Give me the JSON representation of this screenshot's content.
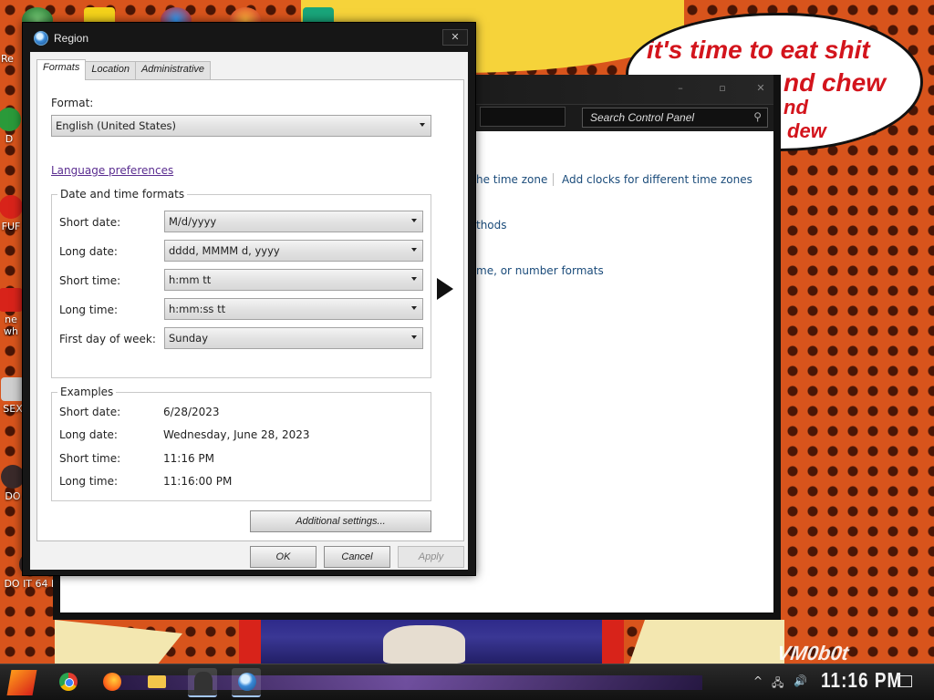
{
  "desktop": {
    "speech_bubble": {
      "line1": "it's time to eat shit",
      "line2": "nd chew",
      "line3": "nd",
      "line4": "dew"
    },
    "watermark": "VM0b0t",
    "icons": [
      {
        "label": "Re"
      },
      {
        "label": "D"
      },
      {
        "label": "FUF"
      },
      {
        "label": "ne"
      },
      {
        "label": "wh"
      },
      {
        "label": "SEX"
      },
      {
        "label": "DO"
      },
      {
        "label": "DO IT 64 B"
      }
    ]
  },
  "control_panel": {
    "search_placeholder": "Search Control Panel",
    "titlebar_buttons": {
      "minimize": "–",
      "maximize": "▫",
      "close": "✕"
    },
    "links": {
      "time_zone": "he time zone",
      "add_clocks": "Add clocks for different time zones",
      "methods": "thods",
      "formats": "me, or number formats"
    }
  },
  "region_dialog": {
    "title": "Region",
    "close_glyph": "✕",
    "tabs": [
      {
        "label": "Formats",
        "active": true
      },
      {
        "label": "Location",
        "active": false
      },
      {
        "label": "Administrative",
        "active": false
      }
    ],
    "format": {
      "label": "Format:",
      "value": "English (United States)"
    },
    "language_link": "Language preferences",
    "date_time_group": {
      "title": "Date and time formats",
      "rows": [
        {
          "label": "Short date:",
          "value": "M/d/yyyy"
        },
        {
          "label": "Long date:",
          "value": "dddd, MMMM d, yyyy"
        },
        {
          "label": "Short time:",
          "value": "h:mm tt"
        },
        {
          "label": "Long time:",
          "value": "h:mm:ss tt"
        },
        {
          "label": "First day of week:",
          "value": "Sunday"
        }
      ]
    },
    "examples_group": {
      "title": "Examples",
      "rows": [
        {
          "label": "Short date:",
          "value": "6/28/2023"
        },
        {
          "label": "Long date:",
          "value": "Wednesday, June 28, 2023"
        },
        {
          "label": "Short time:",
          "value": "11:16 PM"
        },
        {
          "label": "Long time:",
          "value": "11:16:00 PM"
        }
      ]
    },
    "buttons": {
      "additional_settings": "Additional settings...",
      "ok": "OK",
      "cancel": "Cancel",
      "apply": "Apply"
    }
  },
  "taskbar": {
    "clock": "11:16 PM",
    "tray": {
      "chevron": "^",
      "network": "🖧",
      "volume": "🔊"
    }
  }
}
